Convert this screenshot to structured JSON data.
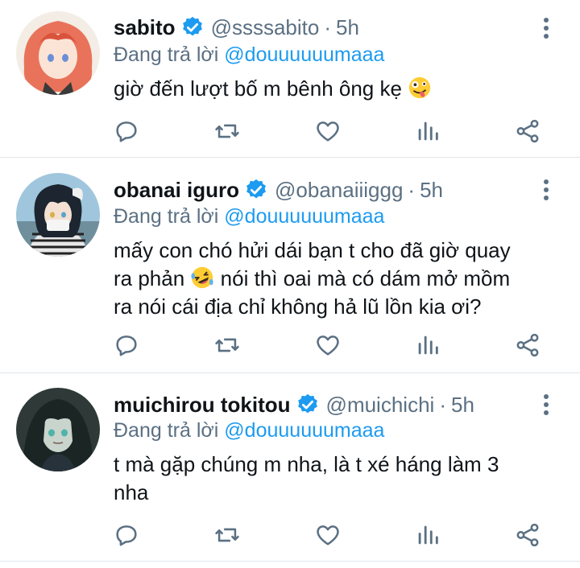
{
  "reply_prefix": "Đang trả lời",
  "tweets": [
    {
      "name": "sabito",
      "handle": "@ssssabito",
      "separator": "·",
      "time": "5h",
      "reply_to": "@douuuuuumaaa",
      "text_lines": [
        "giờ đến lượt bố m bênh ông kẹ"
      ],
      "emoji": "zany-face-emoji",
      "avatar": "anime-avatar-red-hair"
    },
    {
      "name": "obanai iguro",
      "handle": "@obanaiiiggg",
      "separator": "·",
      "time": "5h",
      "reply_to": "@douuuuuumaaa",
      "text_lines": [
        "mấy con chó hửi dái bạn t cho đã giờ quay",
        "ra phản",
        "nói thì oai mà có dám mở mồm",
        "ra nói cái địa chỉ không hả lũ lồn kia ơi?"
      ],
      "emoji": "rolling-laughing-emoji",
      "avatar": "anime-avatar-dark-hair-snake"
    },
    {
      "name": "muichirou tokitou",
      "handle": "@muichichi",
      "separator": "·",
      "time": "5h",
      "reply_to": "@douuuuuumaaa",
      "text_lines": [
        "t mà gặp chúng m nha, là t xé háng làm 3",
        "nha"
      ],
      "emoji": "",
      "avatar": "anime-avatar-long-dark-hair"
    }
  ],
  "colors": {
    "accent": "#1d9bf0",
    "secondary_text": "#5b7083",
    "divider": "#e1e6ea"
  }
}
